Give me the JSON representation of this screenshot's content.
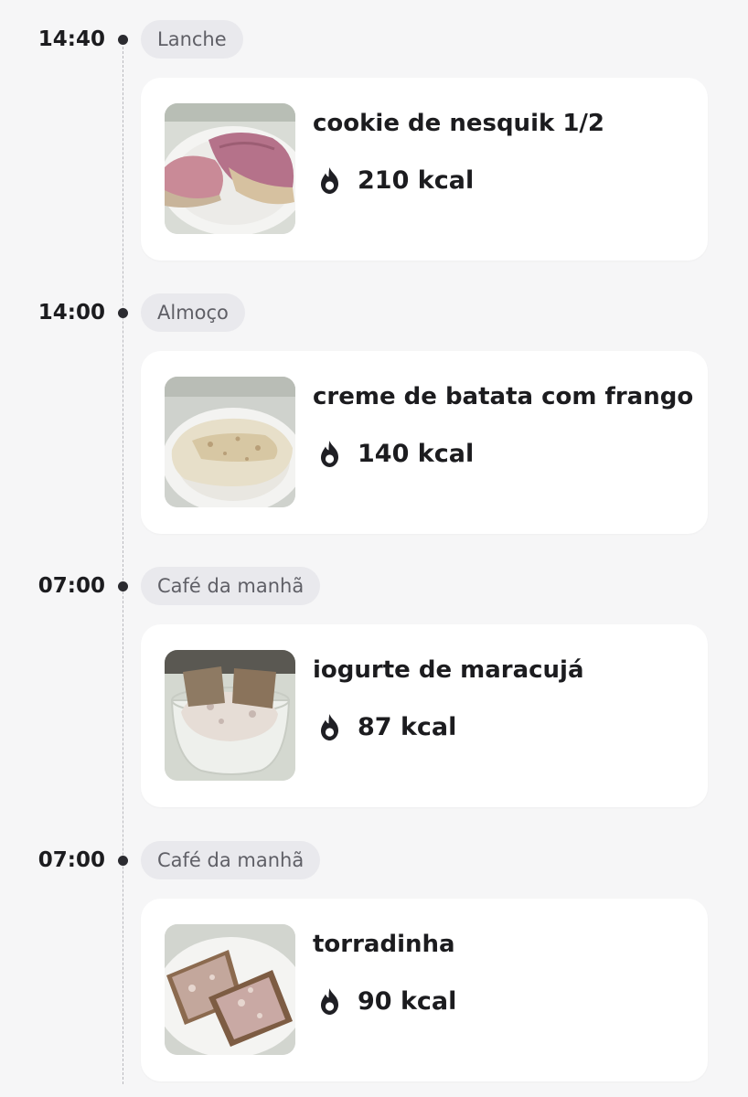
{
  "entries": [
    {
      "time": "14:40",
      "meal": "Lanche",
      "food": "cookie de nesquik 1/2",
      "kcal": "210 kcal",
      "photo_icon": "cookie-photo"
    },
    {
      "time": "14:00",
      "meal": "Almoço",
      "food": "creme de batata com frango",
      "kcal": "140 kcal",
      "photo_icon": "potato-cream-photo"
    },
    {
      "time": "07:00",
      "meal": "Café da manhã",
      "food": "iogurte de maracujá",
      "kcal": "87 kcal",
      "photo_icon": "yogurt-photo"
    },
    {
      "time": "07:00",
      "meal": "Café da manhã",
      "food": "torradinha",
      "kcal": "90 kcal",
      "photo_icon": "toast-photo"
    }
  ],
  "icons": {
    "calorie": "flame-icon"
  },
  "colors": {
    "background": "#f6f6f7",
    "card": "#ffffff",
    "tag_background": "#e9e9ed",
    "tag_text": "#5f5f66",
    "text": "#1c1c1f"
  }
}
